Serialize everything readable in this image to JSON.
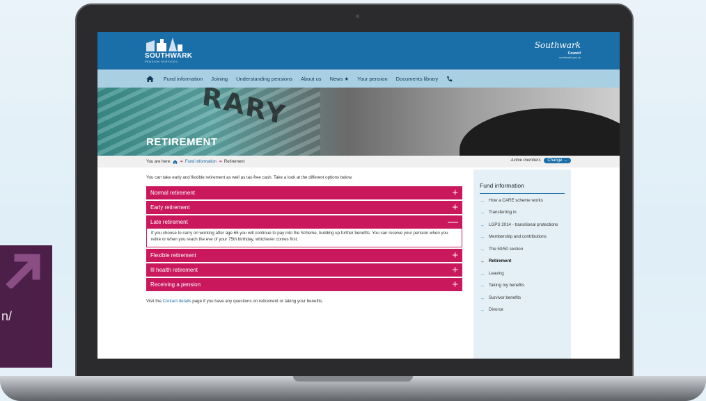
{
  "promo": {
    "text": "n/"
  },
  "header": {
    "logo_word": "SOUTHWARK",
    "logo_sub": "PENSION SERVICES",
    "council_script": "Southwark",
    "council_word": "Council",
    "council_url": "southwark.gov.uk"
  },
  "nav": {
    "items": [
      "Fund information",
      "Joining",
      "Understanding pensions",
      "About us",
      "News ★",
      "Your pension",
      "Documents library"
    ]
  },
  "hero": {
    "title": "RETIREMENT",
    "letters": "RARY"
  },
  "breadcrumb": {
    "prefix": "You are here:",
    "items": [
      "Fund information",
      "Retirement"
    ],
    "active_label": "Active members",
    "change_label": "Change →"
  },
  "main": {
    "intro": "You can take early and flexible retirement as well as tax-free cash. Take a look at the different options below.",
    "accordion": [
      {
        "label": "Normal retirement",
        "toggle": "+"
      },
      {
        "label": "Early retirement",
        "toggle": "+"
      },
      {
        "label": "Late retirement",
        "toggle": "—",
        "body": "If you choose to carry on working after age 65 you will continue to pay into the Scheme, building up further benefits. You can receive your pension when you retire or when you reach the eve of your 75th birthday, whichever comes first."
      },
      {
        "label": "Flexible retirement",
        "toggle": "+"
      },
      {
        "label": "Ill health retirement",
        "toggle": "+"
      },
      {
        "label": "Receiving a pension",
        "toggle": "+"
      }
    ],
    "footer_pre": "Visit the ",
    "footer_link": "Contact details",
    "footer_post": " page if you have any questions on retirement or taking your benefits."
  },
  "sidebar": {
    "title": "Fund information",
    "items": [
      "How a CARE scheme works",
      "Transferring in",
      "LGPS 2014 - transitional protections",
      "Membership and contributions",
      "The 50/50 section",
      "Retirement",
      "Leaving",
      "Taking my benefits",
      "Survivor benefits",
      "Divorce"
    ],
    "current": "Retirement"
  },
  "colors": {
    "header": "#1b6fa8",
    "nav": "#a9cfe3",
    "accordion": "#c9185c",
    "sidebar": "#e4f0f6"
  }
}
